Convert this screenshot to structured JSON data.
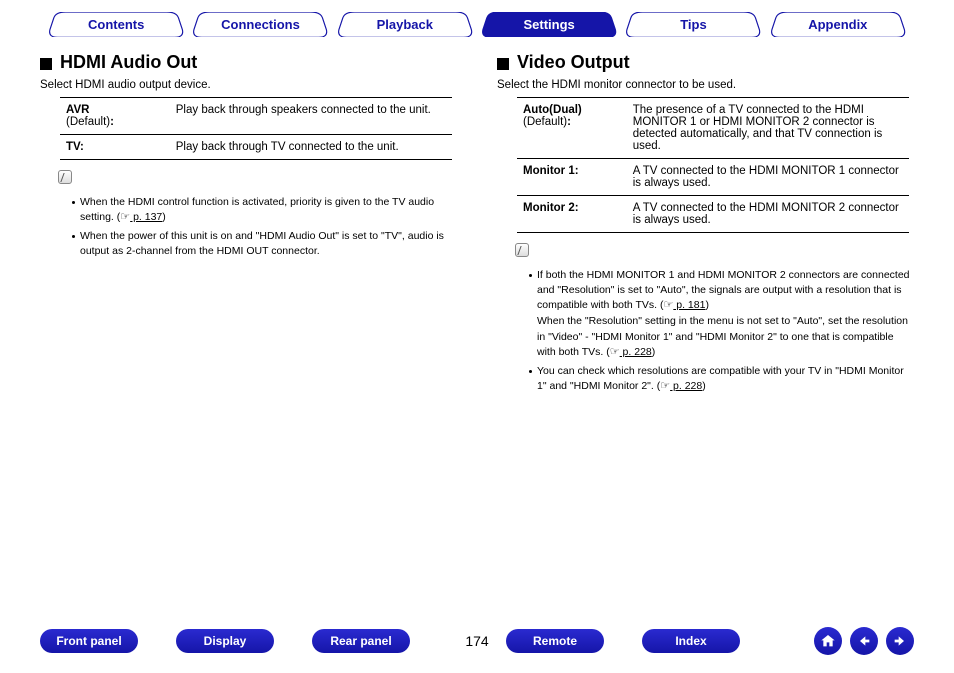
{
  "tabs": [
    {
      "label": "Contents",
      "active": false
    },
    {
      "label": "Connections",
      "active": false
    },
    {
      "label": "Playback",
      "active": false
    },
    {
      "label": "Settings",
      "active": true
    },
    {
      "label": "Tips",
      "active": false
    },
    {
      "label": "Appendix",
      "active": false
    }
  ],
  "left": {
    "heading": "HDMI Audio Out",
    "subhead": "Select HDMI audio output device.",
    "rows": [
      {
        "key_bold": "AVR",
        "key_tail": "(Default)",
        "val": "Play back through speakers connected to the unit."
      },
      {
        "key_bold": "TV:",
        "key_tail": "",
        "val": "Play back through TV connected to the unit."
      }
    ],
    "notes": [
      {
        "pre": "When the HDMI control function is activated, priority is given to the TV audio setting.  (",
        "hand": "☞",
        "pg": " p. 137",
        "post": ")"
      },
      {
        "pre": "When the power of this unit is on and \"HDMI Audio Out\" is set to \"TV\", audio is output as 2-channel from the HDMI OUT connector.",
        "hand": "",
        "pg": "",
        "post": ""
      }
    ]
  },
  "right": {
    "heading": "Video Output",
    "subhead": "Select the HDMI monitor connector to be used.",
    "rows": [
      {
        "key_bold": "Auto(Dual)",
        "key_tail": "(Default)",
        "val": "The presence of a TV connected to the HDMI MONITOR 1 or HDMI MONITOR 2 connector is detected automatically, and that TV connection is used."
      },
      {
        "key_bold": "Monitor 1:",
        "key_tail": "",
        "val": "A TV connected to the HDMI MONITOR 1 connector is always used."
      },
      {
        "key_bold": "Monitor 2:",
        "key_tail": "",
        "val": "A TV connected to the HDMI MONITOR 2 connector is always used."
      }
    ],
    "notes": [
      {
        "pre": "If both the HDMI MONITOR 1 and HDMI MONITOR 2 connectors are connected and \"Resolution\" is set to \"Auto\", the signals are output with a resolution that is compatible with both TVs.  (",
        "hand": "☞",
        "pg": " p. 181",
        "post": ")\nWhen the \"Resolution\" setting in the menu is not set to \"Auto\", set the resolution in \"Video\" - \"HDMI Monitor 1\" and \"HDMI Monitor 2\" to one that is compatible with both TVs.  (",
        "hand2": "☞",
        "pg2": " p. 228",
        "post2": ")"
      },
      {
        "pre": "You can check which resolutions are compatible with your TV in \"HDMI Monitor 1\" and \"HDMI Monitor 2\".  (",
        "hand": "☞",
        "pg": " p. 228",
        "post": ")"
      }
    ]
  },
  "footer": {
    "buttons": [
      "Front panel",
      "Display",
      "Rear panel"
    ],
    "page": "174",
    "buttons_right": [
      "Remote",
      "Index"
    ]
  }
}
